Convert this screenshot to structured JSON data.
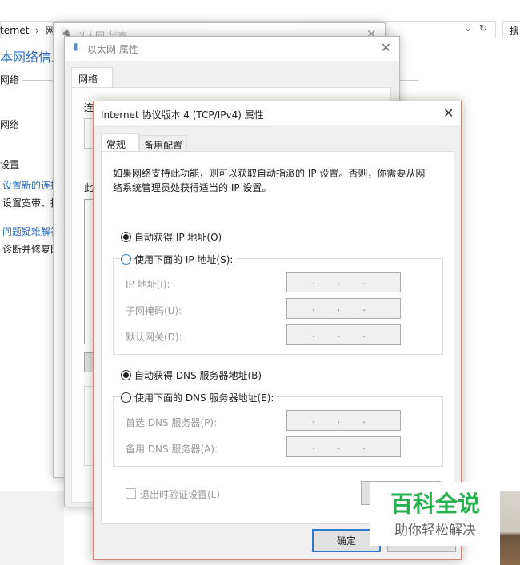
{
  "explorer": {
    "address": "ternet  ›  网",
    "search": "搜",
    "heading": "本网络信息",
    "section_network": "网络",
    "network_item": "网络",
    "section_settings": "设置",
    "link_new_connection": "设置新的连接",
    "new_connection_desc": "设置宽带、拨",
    "link_troubleshoot": "问题疑难解答",
    "troubleshoot_desc": "诊断并修复网"
  },
  "status_window": {
    "title": "以太网 状态"
  },
  "properties_window": {
    "title": "以太网 属性",
    "tab": "网络",
    "connect_label": "连",
    "this_label": "此"
  },
  "dialog": {
    "title": "Internet 协议版本 4 (TCP/IPv4) 属性",
    "tabs": [
      "常规",
      "备用配置"
    ],
    "description_line1": "如果网络支持此功能，则可以获取自动指派的 IP 设置。否则，你需要从网",
    "description_line2": "络系统管理员处获得适当的 IP 设置。",
    "ip_auto": "自动获得 IP 地址(O)",
    "ip_manual": "使用下面的 IP 地址(S):",
    "ip_fields": [
      {
        "label": "IP 地址(I):",
        "value": ". . ."
      },
      {
        "label": "子网掩码(U):",
        "value": ". . ."
      },
      {
        "label": "默认网关(D):",
        "value": ". . ."
      }
    ],
    "dns_auto": "自动获得 DNS 服务器地址(B)",
    "dns_manual": "使用下面的 DNS 服务器地址(E):",
    "dns_fields": [
      {
        "label": "首选 DNS 服务器(P):",
        "value": ". . ."
      },
      {
        "label": "备用 DNS 服务器(A):",
        "value": ". . ."
      }
    ],
    "validate_checkbox": "退出时验证设置(L)",
    "ok": "确定",
    "selected_ip_mode": "auto",
    "selected_dns_mode": "auto"
  },
  "watermark": {
    "title": "百科全说",
    "subtitle": "助你轻松解决",
    "color": "#22b14c"
  }
}
